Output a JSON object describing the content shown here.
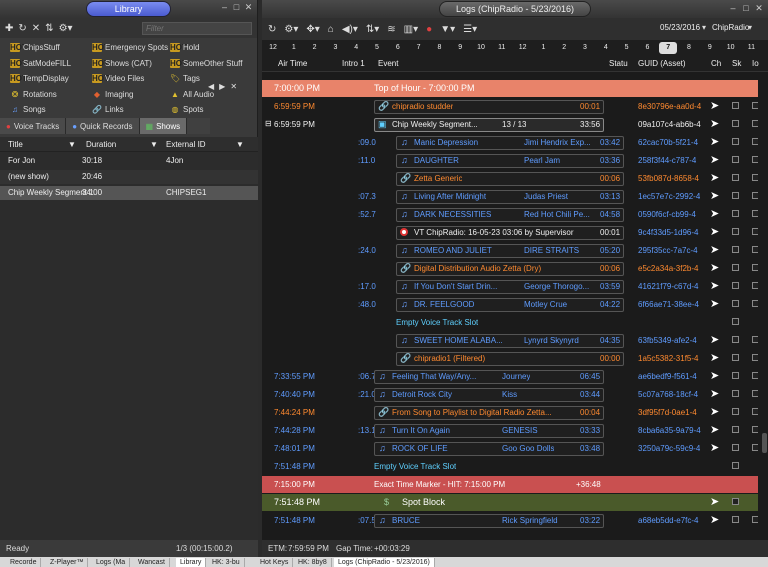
{
  "library": {
    "title": "Library",
    "filter_placeholder": "Filter",
    "categories": [
      {
        "label": "ChipsStuff",
        "icon": "hot-icon"
      },
      {
        "label": "Emergency Spots",
        "icon": "hot-icon"
      },
      {
        "label": "Hold",
        "icon": "hot-icon"
      },
      {
        "label": "SatModeFILL",
        "icon": "hot-icon"
      },
      {
        "label": "Shows (CAT)",
        "icon": "hot-icon"
      },
      {
        "label": "SomeOther Stuff",
        "icon": "hot-icon"
      },
      {
        "label": "TempDisplay",
        "icon": "hot-icon"
      },
      {
        "label": "Video Files",
        "icon": "hot-icon"
      },
      {
        "label": "Tags",
        "icon": "tag-icon"
      },
      {
        "label": "Rotations",
        "icon": "rotation-icon"
      },
      {
        "label": "Imaging",
        "icon": "imaging-icon"
      },
      {
        "label": "All Audio",
        "icon": "all-audio-icon"
      },
      {
        "label": "Songs",
        "icon": "note-icon"
      },
      {
        "label": "Links",
        "icon": "link-icon"
      },
      {
        "label": "Spots",
        "icon": "spots-icon"
      }
    ],
    "tabs": [
      {
        "label": "Voice Tracks"
      },
      {
        "label": "Quick Records"
      },
      {
        "label": "Shows"
      }
    ],
    "columns": {
      "title": "Title",
      "duration": "Duration",
      "external_id": "External ID"
    },
    "rows": [
      {
        "title": "For Jon",
        "duration": "30:18",
        "external_id": "4Jon"
      },
      {
        "title": "(new show)",
        "duration": "20:46",
        "external_id": ""
      },
      {
        "title": "Chip Weekly Segment 1",
        "duration": "34:00",
        "external_id": "CHIPSEG1"
      }
    ],
    "status_left": "Ready",
    "status_right": "1/3 (00:15:00.2)"
  },
  "logs": {
    "title": "Logs (ChipRadio - 5/23/2016)",
    "date": "05/23/2016",
    "station": "ChipRadio",
    "hours": [
      "12",
      "1",
      "2",
      "3",
      "4",
      "5",
      "6",
      "7",
      "8",
      "9",
      "10",
      "11",
      "12",
      "1",
      "2",
      "3",
      "4",
      "5",
      "6",
      "7",
      "8",
      "9",
      "10",
      "11"
    ],
    "active_hour_index": 19,
    "columns": {
      "air_time": "Air Time",
      "intro": "Intro 1",
      "event": "Event",
      "status": "Statu",
      "guid": "GUID (Asset)",
      "ch": "Ch",
      "sk": "Sk",
      "lo": "Io"
    },
    "hour_header": {
      "time": "7:00:00 PM",
      "label": "Top of Hour - 7:00:00 PM"
    },
    "rows": [
      {
        "time": "6:59:59 PM",
        "intro": "",
        "title": "chipradio studder",
        "artist": "",
        "dur": "00:01",
        "guid": "8e30796e-aa0d-4",
        "kind": "link-orange"
      },
      {
        "time": "6:59:59 PM",
        "intro": "",
        "title": "Chip Weekly Segment...",
        "artist": "13 / 13",
        "dur": "33:56",
        "guid": "09a107c4-ab6b-4",
        "kind": "segment"
      },
      {
        "time": "",
        "intro": ":09.0",
        "title": "Manic Depression",
        "artist": "Jimi Hendrix Exp...",
        "dur": "03:42",
        "guid": "62cac70b-5f21-4",
        "kind": "song"
      },
      {
        "time": "",
        "intro": ":11.0",
        "title": "DAUGHTER",
        "artist": "Pearl Jam",
        "dur": "03:36",
        "guid": "258f3f44-c787-4",
        "kind": "song"
      },
      {
        "time": "",
        "intro": "",
        "title": "Zetta Generic",
        "artist": "",
        "dur": "00:06",
        "guid": "53fb087d-8658-4",
        "kind": "link-orange"
      },
      {
        "time": "",
        "intro": ":07.3",
        "title": "Living After Midnight",
        "artist": "Judas Priest",
        "dur": "03:13",
        "guid": "1ec57e7c-2992-4",
        "kind": "song"
      },
      {
        "time": "",
        "intro": ":52.7",
        "title": "DARK NECESSITIES",
        "artist": "Red Hot Chili Pe...",
        "dur": "04:58",
        "guid": "0590f6cf-cb99-4",
        "kind": "song"
      },
      {
        "time": "",
        "intro": "",
        "title": "VT ChipRadio: 16-05-23 03:06 by Supervisor",
        "artist": "",
        "dur": "00:01",
        "guid": "9c4f33d5-1d96-4",
        "kind": "vt"
      },
      {
        "time": "",
        "intro": ":24.0",
        "title": "ROMEO AND JULIET",
        "artist": "DIRE STRAITS",
        "dur": "05:20",
        "guid": "295f35cc-7a7c-4",
        "kind": "song"
      },
      {
        "time": "",
        "intro": "",
        "title": "Digital Distribution Audio Zetta (Dry)",
        "artist": "",
        "dur": "00:06",
        "guid": "e5c2a34a-3f2b-4",
        "kind": "link-orange"
      },
      {
        "time": "",
        "intro": ":17.0",
        "title": "If You Don't Start Drin...",
        "artist": "George Thorogo...",
        "dur": "03:59",
        "guid": "41621f79-c67d-4",
        "kind": "song"
      },
      {
        "time": "",
        "intro": ":48.0",
        "title": "DR. FEELGOOD",
        "artist": "Motley Crue",
        "dur": "04:22",
        "guid": "6f66ae71-38ee-4",
        "kind": "song"
      },
      {
        "time": "",
        "intro": "",
        "title": "Empty Voice Track Slot",
        "artist": "",
        "dur": "",
        "guid": "",
        "kind": "empty-inner"
      },
      {
        "time": "",
        "intro": "",
        "title": "SWEET HOME ALABA...",
        "artist": "Lynyrd Skynyrd",
        "dur": "04:35",
        "guid": "63fb5349-afe2-4",
        "kind": "song"
      },
      {
        "time": "",
        "intro": "",
        "title": "chipradio1 (Filtered)",
        "artist": "",
        "dur": "00:00",
        "guid": "1a5c5382-31f5-4",
        "kind": "link-orange"
      },
      {
        "time": "7:33:55 PM",
        "intro": ":06.7",
        "title": "Feeling That Way/Any...",
        "artist": "Journey",
        "dur": "06:45",
        "guid": "ae6bedf9-f561-4",
        "kind": "song-top"
      },
      {
        "time": "7:40:40 PM",
        "intro": ":21.0",
        "title": "Detroit Rock City",
        "artist": "Kiss",
        "dur": "03:44",
        "guid": "5c07a768-18cf-4",
        "kind": "song-top"
      },
      {
        "time": "7:44:24 PM",
        "intro": "",
        "title": "From Song to Playlist to Digital Radio Zetta...",
        "artist": "",
        "dur": "00:04",
        "guid": "3df95f7d-0ae1-4",
        "kind": "link-orange-top"
      },
      {
        "time": "7:44:28 PM",
        "intro": ":13.1",
        "title": "Turn It On Again",
        "artist": "GENESIS",
        "dur": "03:33",
        "guid": "8cba6a35-9a79-4",
        "kind": "song-top"
      },
      {
        "time": "7:48:01 PM",
        "intro": "",
        "title": "ROCK OF LIFE",
        "artist": "Goo Goo Dolls",
        "dur": "03:48",
        "guid": "3250a79c-59c9-4",
        "kind": "song-top"
      },
      {
        "time": "7:51:48 PM",
        "intro": "",
        "title": "Empty Voice Track Slot",
        "artist": "",
        "dur": "",
        "guid": "",
        "kind": "empty-top"
      },
      {
        "time": "7:15:00 PM",
        "intro": "",
        "title": "Exact Time Marker - HIT: 7:15:00 PM",
        "artist": "",
        "dur": "+36:48",
        "guid": "",
        "kind": "marker"
      },
      {
        "time": "7:51:48 PM",
        "intro": "",
        "title": "Spot Block",
        "artist": "",
        "dur": "",
        "guid": "",
        "kind": "spot"
      },
      {
        "time": "7:51:48 PM",
        "intro": ":07.5",
        "title": "BRUCE",
        "artist": "Rick Springfield",
        "dur": "03:22",
        "guid": "a68eb5dd-e7fc-4",
        "kind": "song-top"
      }
    ],
    "etm_label": "ETM:",
    "etm_value": "7:59:59 PM",
    "gap_label": "Gap Time:",
    "gap_value": "+00:03:29"
  },
  "taskbar": [
    "Recorde",
    "Z-Player™",
    "Logs (Ma",
    "Wancast",
    "Library",
    "HK: 3-bu",
    "Hot Keys",
    "HK: 8by8",
    "Logs (ChipRadio - 5/23/2016)"
  ]
}
